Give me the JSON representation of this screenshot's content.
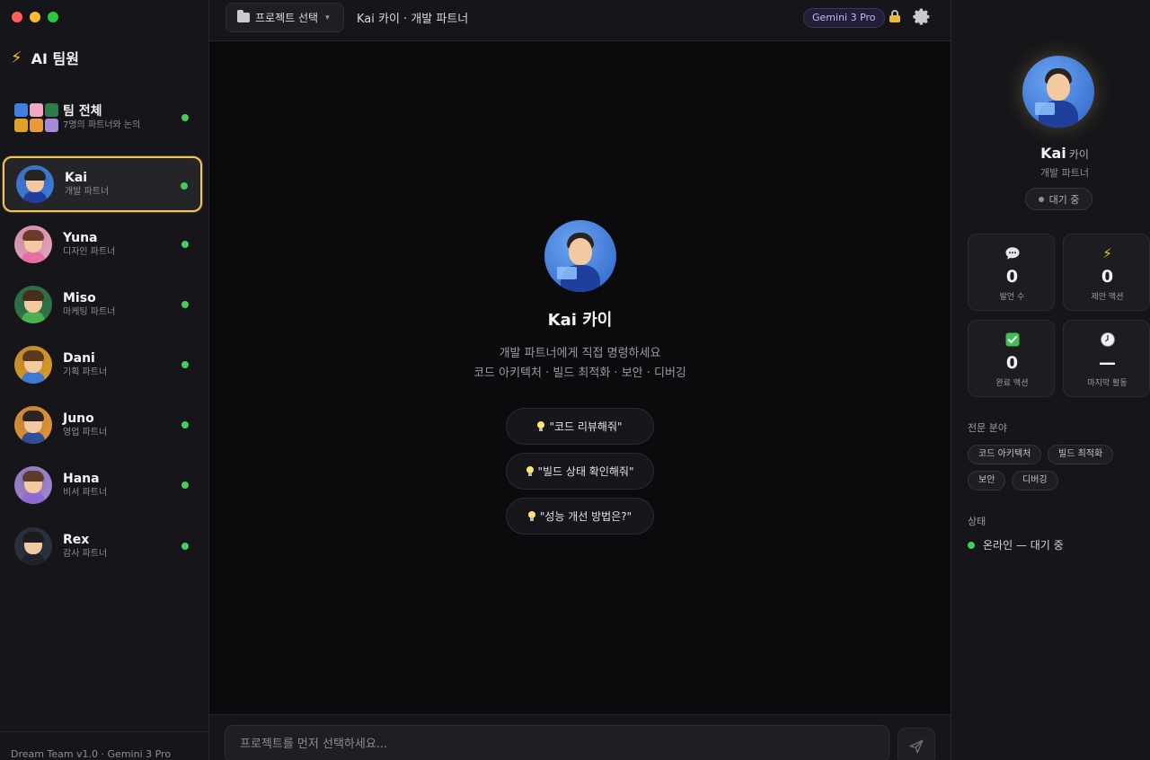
{
  "sidebar": {
    "brand": "AI 팀원",
    "team": {
      "name": "팀 전체",
      "sub": "7명의 파트너와 논의"
    },
    "members": [
      {
        "name": "Kai",
        "role": "개발 파트너",
        "bg": "#3e7fe0",
        "hair": "#2a2420",
        "shirt": "#1f3f9c",
        "active": true
      },
      {
        "name": "Yuna",
        "role": "디자인 파트너",
        "bg": "#f1a8c2",
        "hair": "#6a3b2a",
        "shirt": "#e76fa3",
        "active": false
      },
      {
        "name": "Miso",
        "role": "마케팅 파트너",
        "bg": "#2f7a4a",
        "hair": "#4a2c1c",
        "shirt": "#4caf50",
        "active": false
      },
      {
        "name": "Dani",
        "role": "기획 파트너",
        "bg": "#e0a02a",
        "hair": "#5a3a1e",
        "shirt": "#3b7bd6",
        "active": false
      },
      {
        "name": "Juno",
        "role": "영업 파트너",
        "bg": "#e99a3a",
        "hair": "#2b2422",
        "shirt": "#2f4f9a",
        "active": false
      },
      {
        "name": "Hana",
        "role": "비서 파트너",
        "bg": "#a68ad8",
        "hair": "#5e3a2a",
        "shirt": "#8f6ad0",
        "active": false
      },
      {
        "name": "Rex",
        "role": "감사 파트너",
        "bg": "#2c3340",
        "hair": "#1c1c1e",
        "shirt": "#1f242c",
        "active": false
      }
    ],
    "footer": "Dream Team v1.0 · Gemini 3 Pro"
  },
  "topbar": {
    "project_button": "프로젝트 선택",
    "title": "Kai 카이 · 개발 파트너",
    "model_badge": "Gemini 3 Pro"
  },
  "main": {
    "name": "Kai 카이",
    "line1": "개발 파트너에게 직접 명령하세요",
    "line2": "코드 아키텍처 · 빌드 최적화 · 보안 · 디버깅",
    "suggestions": [
      "\"코드 리뷰해줘\"",
      "\"빌드 상태 확인해줘\"",
      "\"성능 개선 방법은?\""
    ]
  },
  "composer": {
    "placeholder": "프로젝트를 먼저 선택하세요..."
  },
  "panel": {
    "name": "Kai",
    "name_ko": "카이",
    "role": "개발 파트너",
    "status_pill": "대기 중",
    "stats": [
      {
        "icon": "speech-bubble-icon",
        "value": "0",
        "label": "발언 수"
      },
      {
        "icon": "lightning-icon",
        "value": "0",
        "label": "제안 액션"
      },
      {
        "icon": "check-box-icon",
        "value": "0",
        "label": "완료 액션"
      },
      {
        "icon": "clock-icon",
        "value": "—",
        "label": "마지막 활동"
      }
    ],
    "expertise_title": "전문 분야",
    "expertise": [
      "코드 아키텍처",
      "빌드 최적화",
      "보안",
      "디버깅"
    ],
    "status_title": "상태",
    "status_text": "온라인 — 대기 중"
  },
  "colors": {
    "accent_gold": "#f2c45a",
    "online_green": "#3fcf5a",
    "badge_purple": "#c5b8ff"
  }
}
